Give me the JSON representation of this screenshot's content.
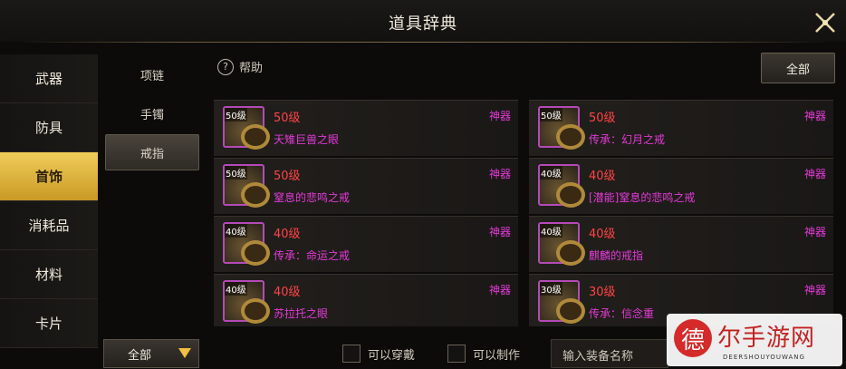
{
  "window": {
    "title": "道具辞典"
  },
  "nav": {
    "items": [
      "武器",
      "防具",
      "首饰",
      "消耗品",
      "材料",
      "卡片"
    ],
    "active": 2
  },
  "subnav": {
    "items": [
      "项链",
      "手镯",
      "戒指"
    ],
    "active": 2
  },
  "help": {
    "icon": "?",
    "label": "帮助"
  },
  "filter_all_label": "全部",
  "items": [
    {
      "level_tag": "50级",
      "level": "50级",
      "rarity": "神器",
      "name": "天雉巨兽之眼"
    },
    {
      "level_tag": "50级",
      "level": "50级",
      "rarity": "神器",
      "name": "传承：幻月之戒"
    },
    {
      "level_tag": "50级",
      "level": "50级",
      "rarity": "神器",
      "name": "窒息的悲鸣之戒"
    },
    {
      "level_tag": "40级",
      "level": "40级",
      "rarity": "神器",
      "name": "[潜能]窒息的悲鸣之戒"
    },
    {
      "level_tag": "40级",
      "level": "40级",
      "rarity": "神器",
      "name": "传承：命运之戒"
    },
    {
      "level_tag": "40级",
      "level": "40级",
      "rarity": "神器",
      "name": "麒麟的戒指"
    },
    {
      "level_tag": "40级",
      "level": "40级",
      "rarity": "神器",
      "name": "苏拉托之眼"
    },
    {
      "level_tag": "30级",
      "level": "30级",
      "rarity": "神器",
      "name": "传承：信念重"
    }
  ],
  "bottom": {
    "select_value": "全部",
    "can_wear": "可以穿戴",
    "can_craft": "可以制作",
    "search_placeholder": "输入装备名称"
  },
  "watermark": {
    "logo": "德",
    "text": "尔手游网",
    "sub": "DEERSHOUYOUWANG"
  }
}
